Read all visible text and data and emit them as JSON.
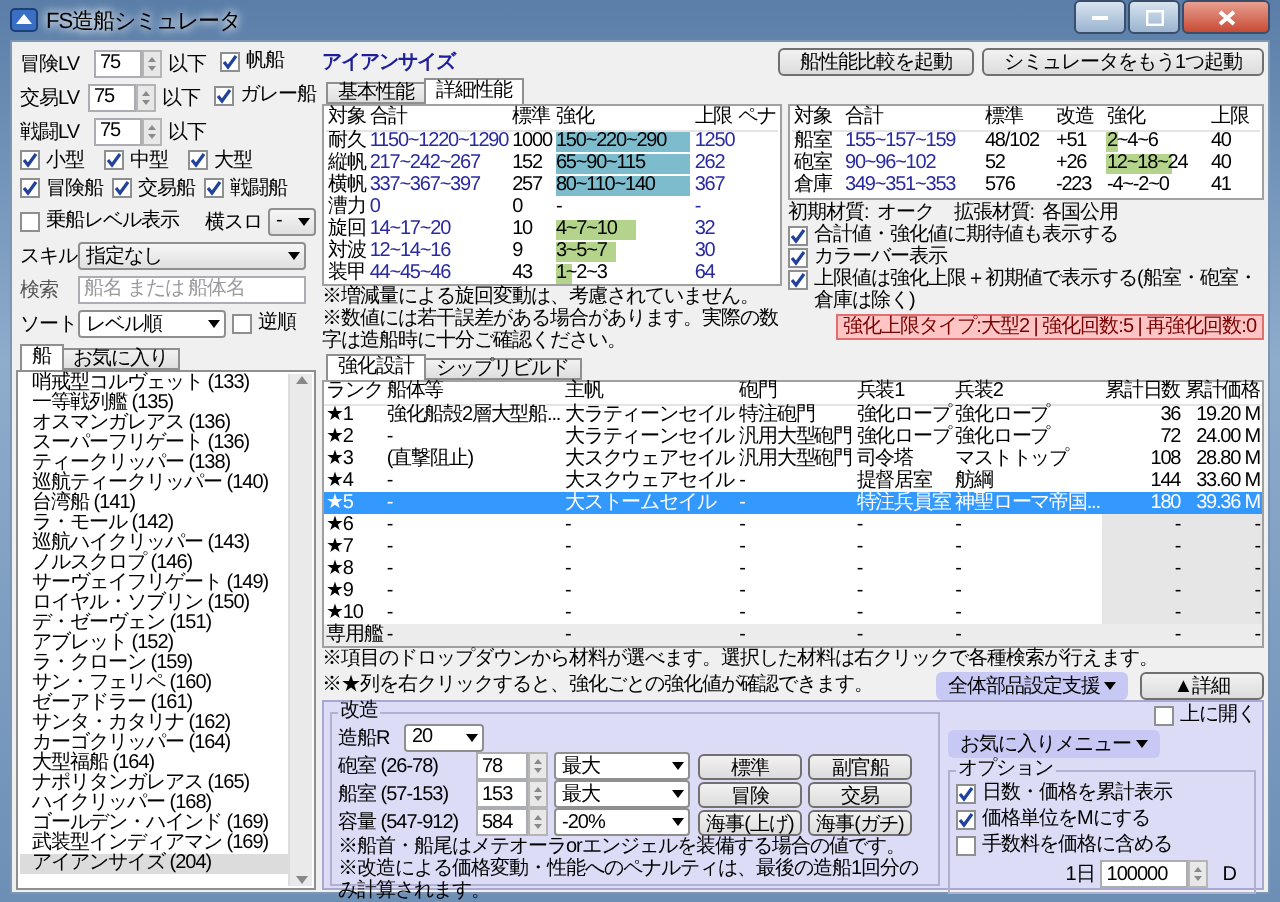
{
  "window": {
    "title": "FS造船シミュレータ"
  },
  "filters": {
    "levels": [
      {
        "label": "冒険LV",
        "value": "75",
        "suffix": "以下"
      },
      {
        "label": "交易LV",
        "value": "75",
        "suffix": "以下"
      },
      {
        "label": "戦闘LV",
        "value": "75",
        "suffix": "以下"
      }
    ],
    "type_checks": [
      {
        "label": "帆船",
        "checked": true
      },
      {
        "label": "ガレー船",
        "checked": true
      }
    ],
    "size_checks": [
      {
        "label": "小型",
        "checked": true
      },
      {
        "label": "中型",
        "checked": true
      },
      {
        "label": "大型",
        "checked": true
      }
    ],
    "role_checks": [
      {
        "label": "冒険船",
        "checked": true
      },
      {
        "label": "交易船",
        "checked": true
      },
      {
        "label": "戦闘船",
        "checked": true
      }
    ],
    "crew_level": {
      "label": "乗船レベル表示",
      "checked": false
    },
    "side_slot": {
      "label": "横スロ",
      "value": "-"
    },
    "skill": {
      "label": "スキル",
      "value": "指定なし"
    },
    "search": {
      "label": "検索",
      "placeholder": "船名 または 船体名"
    },
    "sort": {
      "label": "ソート",
      "value": "レベル順",
      "reverse": {
        "label": "逆順",
        "checked": false
      }
    }
  },
  "ship_tabs": [
    {
      "label": "船",
      "selected": true
    },
    {
      "label": "お気に入り",
      "selected": false
    }
  ],
  "ships": [
    {
      "name": "哨戒型コルヴェット (133)",
      "selected": false
    },
    {
      "name": "一等戦列艦 (135)",
      "selected": false
    },
    {
      "name": "オスマンガレアス (136)",
      "selected": false
    },
    {
      "name": "スーパーフリゲート (136)",
      "selected": false
    },
    {
      "name": "ティークリッパー (138)",
      "selected": false
    },
    {
      "name": "巡航ティークリッパー (140)",
      "selected": false
    },
    {
      "name": "台湾船 (141)",
      "selected": false
    },
    {
      "name": "ラ・モール (142)",
      "selected": false
    },
    {
      "name": "巡航ハイクリッパー (143)",
      "selected": false
    },
    {
      "name": "ノルスクロプ (146)",
      "selected": false
    },
    {
      "name": "サーヴェイフリゲート (149)",
      "selected": false
    },
    {
      "name": "ロイヤル・ソブリン (150)",
      "selected": false
    },
    {
      "name": "デ・ゼーヴェン (151)",
      "selected": false
    },
    {
      "name": "アブレット (152)",
      "selected": false
    },
    {
      "name": "ラ・クローン (159)",
      "selected": false
    },
    {
      "name": "サン・フェリペ (160)",
      "selected": false
    },
    {
      "name": "ゼーアドラー (161)",
      "selected": false
    },
    {
      "name": "サンタ・カタリナ (162)",
      "selected": false
    },
    {
      "name": "カーゴクリッパー (164)",
      "selected": false
    },
    {
      "name": "大型福船 (164)",
      "selected": false
    },
    {
      "name": "ナポリタンガレアス (165)",
      "selected": false
    },
    {
      "name": "ハイクリッパー (168)",
      "selected": false
    },
    {
      "name": "ゴールデン・ハインド (169)",
      "selected": false
    },
    {
      "name": "武装型インディアマン (169)",
      "selected": false
    },
    {
      "name": "アイアンサイズ (204)",
      "selected": true
    }
  ],
  "top_buttons": [
    "船性能比較を起動",
    "シミュレータをもう1つ起動"
  ],
  "ship_name": "アイアンサイズ",
  "stat_tabs": [
    {
      "label": "基本性能",
      "selected": false
    },
    {
      "label": "詳細性能",
      "selected": true
    }
  ],
  "stats": {
    "columns": [
      "対象",
      "合計",
      "標準",
      "強化",
      "上限",
      "ペナ"
    ],
    "rows": [
      {
        "target": "耐久",
        "total": "1150~1220~1290",
        "base": "1000",
        "boost": "150~220~290",
        "level": 1,
        "color": "#7dbccd",
        "limit": "1250"
      },
      {
        "target": "縦帆",
        "total": "217~242~267",
        "base": "152",
        "boost": "65~90~115",
        "level": 1,
        "color": "#7dbccd",
        "limit": "262"
      },
      {
        "target": "横帆",
        "total": "337~367~397",
        "base": "257",
        "boost": "80~110~140",
        "level": 1,
        "color": "#7dbccd",
        "limit": "367"
      },
      {
        "target": "漕力",
        "total": "0",
        "base": "0",
        "boost": "-",
        "limit": "-"
      },
      {
        "target": "旋回",
        "total": "14~17~20",
        "base": "10",
        "boost": "4~7~10",
        "level": 0.6,
        "color": "#b4d48c",
        "limit": "32"
      },
      {
        "target": "対波",
        "total": "12~14~16",
        "base": "9",
        "boost": "3~5~7",
        "level": 0.45,
        "color": "#b4d48c",
        "limit": "30"
      },
      {
        "target": "装甲",
        "total": "44~45~46",
        "base": "43",
        "boost": "1~2~3",
        "level": 0.12,
        "color": "#b4d48c",
        "limit": "64"
      }
    ]
  },
  "capacity": {
    "columns": [
      "対象",
      "合計",
      "標準",
      "改造",
      "強化",
      "上限"
    ],
    "rows": [
      {
        "target": "船室",
        "total": "155~157~159",
        "base": "48/102",
        "mod": "+51",
        "boost": "2~4~6",
        "level": 0.12,
        "color": "#b4d48c",
        "limit": "40"
      },
      {
        "target": "砲室",
        "total": "90~96~102",
        "base": "52",
        "mod": "+26",
        "boost": "12~18~24",
        "level": 0.65,
        "color": "#b4d48c",
        "limit": "40"
      },
      {
        "target": "倉庫",
        "total": "349~351~353",
        "base": "576",
        "mod": "-223",
        "boost": "-4~-2~0",
        "limit": "41"
      }
    ]
  },
  "materials": [
    {
      "label": "初期材質:",
      "value": "オーク"
    },
    {
      "label": "拡張材質:",
      "value": "各国公用"
    }
  ],
  "display_options": [
    {
      "label": "合計値・強化値に期待値も表示する",
      "checked": true
    },
    {
      "label": "カラーバー表示",
      "checked": true
    },
    {
      "label": "上限値は強化上限＋初期値で表示する(船室・砲室・倉庫は除く)",
      "checked": true
    }
  ],
  "stat_notes": [
    "※増減量による旋回変動は、考慮されていません。",
    "※数値には若干誤差がある場合があります。実際の数字は造船時に十分ご確認ください。"
  ],
  "limit_info": "強化上限タイプ:大型2 | 強化回数:5 | 再強化回数:0",
  "design_tabs": [
    {
      "label": "強化設計",
      "selected": true
    },
    {
      "label": "シップリビルド",
      "selected": false
    }
  ],
  "design": {
    "columns": [
      "ランク",
      "船体等",
      "主帆",
      "砲門",
      "兵装1",
      "兵装2",
      "累計日数",
      "累計価格"
    ],
    "rows": [
      {
        "kind": "filled",
        "selected": false,
        "cells": [
          "★1",
          "強化船殻2層大型船...",
          "大ラティーンセイル",
          "特注砲門",
          "強化ロープ",
          "強化ロープ",
          "36",
          "19.20 M"
        ]
      },
      {
        "kind": "filled",
        "selected": false,
        "cells": [
          "★2",
          "-",
          "大ラティーンセイル",
          "汎用大型砲門",
          "強化ロープ",
          "強化ロープ",
          "72",
          "24.00 M"
        ]
      },
      {
        "kind": "filled",
        "selected": false,
        "cells": [
          "★3",
          "(直撃阻止)",
          "大スクウェアセイル",
          "汎用大型砲門",
          "司令塔",
          "マストトップ",
          "108",
          "28.80 M"
        ]
      },
      {
        "kind": "filled",
        "selected": false,
        "cells": [
          "★4",
          "-",
          "大スクウェアセイル",
          "-",
          "提督居室",
          "舫綱",
          "144",
          "33.60 M"
        ]
      },
      {
        "kind": "filled",
        "selected": true,
        "cells": [
          "★5",
          "-",
          "大ストームセイル",
          "-",
          "特注兵員室",
          "神聖ローマ帝国...",
          "180",
          "39.36 M"
        ]
      },
      {
        "kind": "empty",
        "selected": false,
        "cells": [
          "★6",
          "-",
          "-",
          "-",
          "-",
          "-",
          "-",
          "-"
        ]
      },
      {
        "kind": "empty",
        "selected": false,
        "cells": [
          "★7",
          "-",
          "-",
          "-",
          "-",
          "-",
          "-",
          "-"
        ]
      },
      {
        "kind": "empty",
        "selected": false,
        "cells": [
          "★8",
          "-",
          "-",
          "-",
          "-",
          "-",
          "-",
          "-"
        ]
      },
      {
        "kind": "empty",
        "selected": false,
        "cells": [
          "★9",
          "-",
          "-",
          "-",
          "-",
          "-",
          "-",
          "-"
        ]
      },
      {
        "kind": "empty",
        "selected": false,
        "cells": [
          "★10",
          "-",
          "-",
          "-",
          "-",
          "-",
          "-",
          "-"
        ]
      },
      {
        "kind": "special",
        "selected": false,
        "cells": [
          "専用艦",
          "-",
          "-",
          "-",
          "-",
          "-",
          "-",
          "-"
        ]
      }
    ]
  },
  "design_notes": [
    "※項目のドロップダウンから材料が選べます。選択した材料は右クリックで各種検索が行えます。",
    "※★列を右クリックすると、強化ごとの強化値が確認できます。"
  ],
  "assist_button": "全体部品設定支援",
  "detail_button": "▲詳細",
  "remodel": {
    "title": "改造",
    "rank": {
      "label": "造船R",
      "value": "20"
    },
    "rows": [
      {
        "label": "砲室 (26-78)",
        "value": "78",
        "option": "最大"
      },
      {
        "label": "船室 (57-153)",
        "value": "153",
        "option": "最大"
      },
      {
        "label": "容量 (547-912)",
        "value": "584",
        "option": "-20%"
      }
    ],
    "buttons": [
      "標準",
      "副官船",
      "冒険",
      "交易",
      "海事(上げ)",
      "海事(ガチ)"
    ],
    "notes": [
      "※船首・船尾はメテオーラorエンジェルを装備する場合の値です。",
      "※改造による価格変動・性能へのペナルティは、最後の造船1回分のみ計算されます。"
    ]
  },
  "open_up": {
    "label": "上に開く",
    "checked": false
  },
  "favorites_menu": "お気に入りメニュー",
  "options": {
    "title": "オプション",
    "checks": [
      {
        "label": "日数・価格を累計表示",
        "checked": true
      },
      {
        "label": "価格単位をMにする",
        "checked": true
      },
      {
        "label": "手数料を価格に含める",
        "checked": false
      }
    ],
    "fee": {
      "label": "1日",
      "value": "100000",
      "unit": "D"
    }
  }
}
